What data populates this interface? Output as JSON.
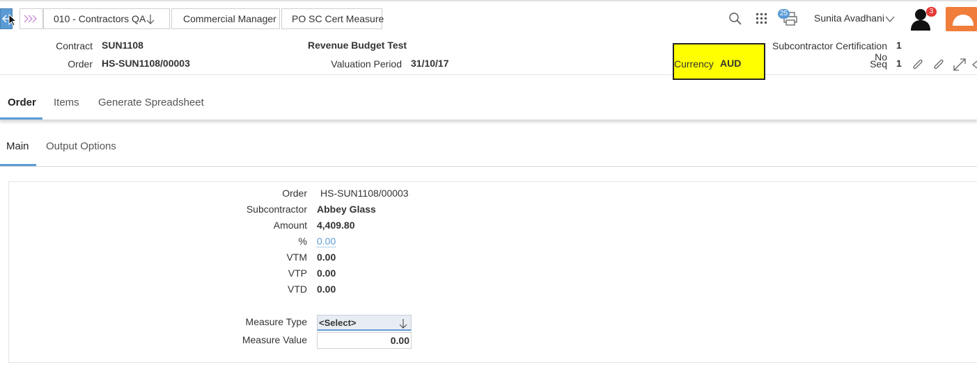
{
  "breadcrumbs": [
    {
      "label": "010 - Contractors QA"
    },
    {
      "label": "Commercial Manager"
    },
    {
      "label": "PO SC Cert Measure"
    }
  ],
  "topbar": {
    "print_badge": "25",
    "user_name": "Sunita Avadhani",
    "notification_badge": "3"
  },
  "header": {
    "contract_label": "Contract",
    "contract_value": "SUN1108",
    "order_label": "Order",
    "order_value": "HS-SUN1108/00003",
    "title": "Revenue Budget Test",
    "valuation_label": "Valuation Period",
    "valuation_value": "31/10/17",
    "currency_label": "Currency",
    "currency_value": "AUD",
    "cert_no_label": "Subcontractor Certification No",
    "cert_no_value": "1",
    "seq_label": "Seq",
    "seq_value": "1"
  },
  "tabs": [
    {
      "label": "Order",
      "active": true
    },
    {
      "label": "Items",
      "active": false
    },
    {
      "label": "Generate Spreadsheet",
      "active": false
    }
  ],
  "subtabs": [
    {
      "label": "Main",
      "active": true
    },
    {
      "label": "Output Options",
      "active": false
    }
  ],
  "form": {
    "order_label": "Order",
    "order_value": "HS-SUN1108/00003",
    "subcontractor_label": "Subcontractor",
    "subcontractor_value": "Abbey Glass",
    "amount_label": "Amount",
    "amount_value": "4,409.80",
    "percent_label": "%",
    "percent_value": "0.00",
    "vtm_label": "VTM",
    "vtm_value": "0.00",
    "vtp_label": "VTP",
    "vtp_value": "0.00",
    "vtd_label": "VTD",
    "vtd_value": "0.00",
    "measure_type_label": "Measure Type",
    "measure_type_value": "<Select>",
    "measure_value_label": "Measure Value",
    "measure_value_value": "0.00"
  },
  "colors": {
    "accent": "#5b9bd5",
    "highlight": "#ffff00",
    "orange": "#f07d3a",
    "badge": "#e53935"
  }
}
